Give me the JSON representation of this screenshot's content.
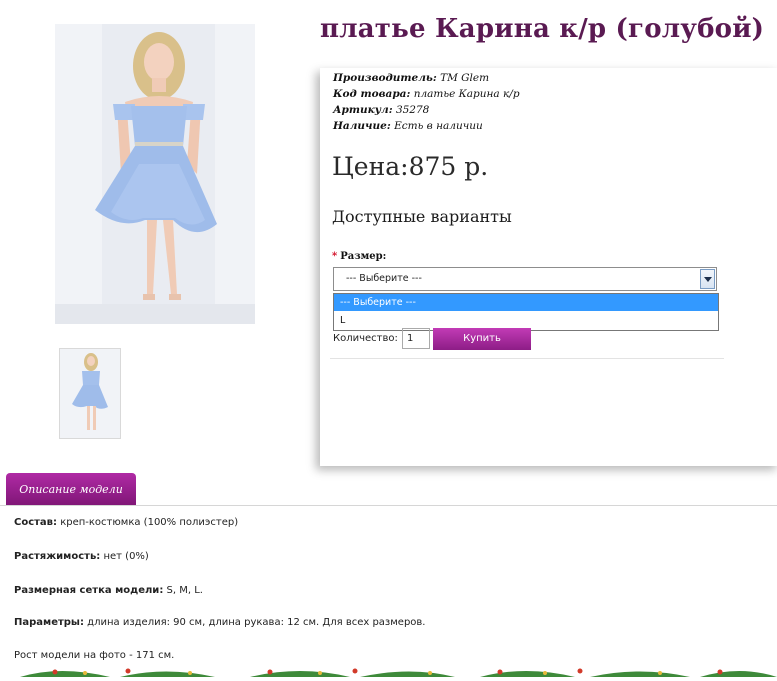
{
  "product": {
    "title": "платье Карина к/р (голубой)",
    "manufacturer_label": "Производитель:",
    "manufacturer_value": "TM Glem",
    "code_label": "Код товара:",
    "code_value": "платье Карина к/р",
    "article_label": "Артикул:",
    "article_value": "35278",
    "stock_label": "Наличие:",
    "stock_value": "Есть в наличии",
    "price": "Цена:875 р.",
    "right_mark": "I"
  },
  "options": {
    "heading": "Доступные варианты",
    "size_label": "Размер:",
    "size_selected": "--- Выберите ---",
    "size_options": [
      "--- Выберите ---",
      "L"
    ]
  },
  "cart": {
    "qty_label": "Количество:",
    "qty_value": "1",
    "buy_label": "Купить"
  },
  "tabs": {
    "description_label": "Описание модели"
  },
  "description": {
    "composition_label": "Состав:",
    "composition_value": "креп-костюмка (100% полиэстер)",
    "stretch_label": "Растяжимость:",
    "stretch_value": "нет (0%)",
    "sizes_label": "Размерная сетка модели:",
    "sizes_value": "S, M, L.",
    "params_label": "Параметры:",
    "params_value": "длина изделия: 90 см, длина рукава: 12 см. Для всех размеров.",
    "model_height": "Рост модели на фото - 171 см."
  },
  "colors": {
    "title": "#5a1a52",
    "accent": "#9c2393",
    "highlight": "#3399ff"
  },
  "icons": {
    "dropdown_arrow": "chevron-down-icon"
  }
}
